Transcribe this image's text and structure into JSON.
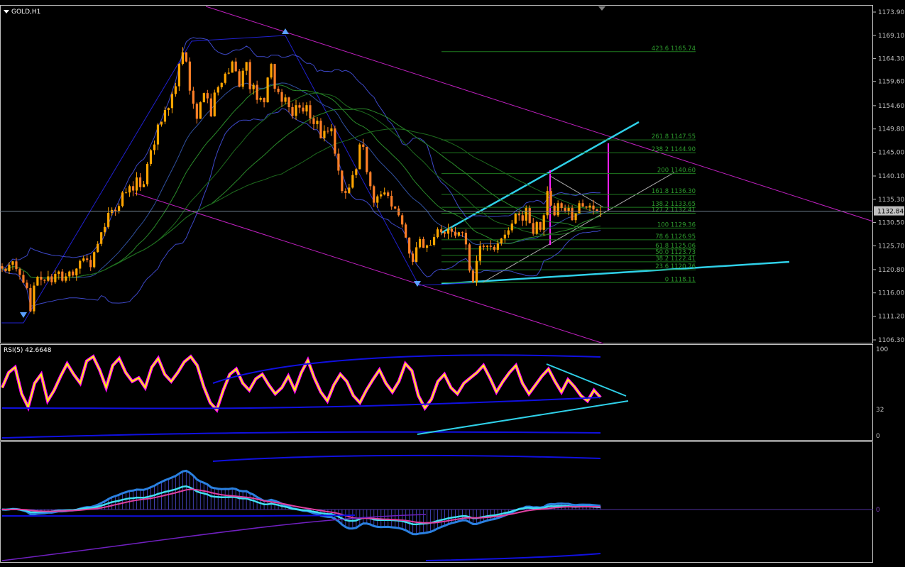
{
  "header": {
    "symbol_label": "GOLD,H1",
    "rsi_label": "RSI(5) 42.6648"
  },
  "colors": {
    "background": "#000000",
    "grid_border": "#c0c0c0",
    "axis_text": "#c0c0c0",
    "candle_up": "#ffa500",
    "candle_down": "#ff7f27",
    "fib": "#1f7a1f",
    "fib_text": "#2e9e2e",
    "channel": "#c020c0",
    "trend_cyan": "#2fd0e8",
    "bollinger": "#3d48c8",
    "zigzag": "#2020d0",
    "rsi_line": "#ffff00",
    "rsi_glow": "#ff00ff",
    "level_blue": "#1010e0",
    "current_price_box": "#c0c0c0"
  },
  "chart_data": {
    "type": "candlestick",
    "symbol": "GOLD",
    "timeframe": "H1",
    "price_axis": {
      "ticks": [
        "1173.90",
        "1169.10",
        "1164.30",
        "1159.60",
        "1154.60",
        "1149.80",
        "1145.00",
        "1140.10",
        "1135.30",
        "1130.50",
        "1125.70",
        "1120.80",
        "1116.00",
        "1111.20",
        "1106.30"
      ],
      "min": 1106.3,
      "max": 1173.9
    },
    "current_price": "1132.84",
    "fibonacci_levels": [
      {
        "label": "423.6 1165.74",
        "price": 1165.74
      },
      {
        "label": "261.8 1147.55",
        "price": 1147.55
      },
      {
        "label": "238.2 1144.90",
        "price": 1144.9
      },
      {
        "label": "200 1140.60",
        "price": 1140.6
      },
      {
        "label": "161.8 1136.30",
        "price": 1136.3
      },
      {
        "label": "138.2 1133.65",
        "price": 1133.65
      },
      {
        "label": "127.2 1132.41",
        "price": 1132.41
      },
      {
        "label": "100 1129.36",
        "price": 1129.36
      },
      {
        "label": "78.6 1126.95",
        "price": 1126.95
      },
      {
        "label": "61.8 1125.06",
        "price": 1125.06
      },
      {
        "label": "50.0 1123.73",
        "price": 1123.73
      },
      {
        "label": "38.2 1122.41",
        "price": 1122.41
      },
      {
        "label": "23.6 1120.76",
        "price": 1120.76
      },
      {
        "label": "0 1118.11",
        "price": 1118.11
      }
    ],
    "close_series": [
      1121.0,
      1120.5,
      1121.8,
      1122.5,
      1120.9,
      1119.7,
      1118.1,
      1117.0,
      1112.2,
      1117.5,
      1119.3,
      1118.7,
      1118.5,
      1119.4,
      1118.2,
      1119.9,
      1120.4,
      1118.5,
      1119.4,
      1120.4,
      1119.6,
      1121.0,
      1122.6,
      1123.1,
      1122.8,
      1121.3,
      1124.4,
      1126.1,
      1128.5,
      1129.6,
      1132.5,
      1133.1,
      1132.9,
      1133.9,
      1136.7,
      1136.7,
      1138.0,
      1137.1,
      1139.8,
      1137.8,
      1138.4,
      1142.6,
      1145.4,
      1146.6,
      1150.7,
      1151.3,
      1153.7,
      1154.1,
      1157.0,
      1158.6,
      1163.2,
      1165.6,
      1163.7,
      1157.7,
      1155.0,
      1151.9,
      1155.3,
      1157.2,
      1156.1,
      1152.4,
      1157.3,
      1158.4,
      1159.3,
      1161.2,
      1161.4,
      1163.7,
      1161.7,
      1158.5,
      1161.8,
      1163.6,
      1158.0,
      1158.9,
      1155.8,
      1156.2,
      1155.3,
      1160.4,
      1163.2,
      1158.1,
      1157.4,
      1155.4,
      1156.3,
      1154.3,
      1152.5,
      1154.7,
      1154.2,
      1153.4,
      1154.7,
      1152.0,
      1150.8,
      1151.5,
      1147.9,
      1149.4,
      1149.3,
      1149.9,
      1144.7,
      1141.2,
      1137.0,
      1136.6,
      1137.7,
      1140.3,
      1141.5,
      1146.6,
      1146.1,
      1140.9,
      1138.0,
      1134.6,
      1135.9,
      1136.3,
      1136.7,
      1136.0,
      1133.8,
      1133.4,
      1132.0,
      1130.1,
      1127.4,
      1124.1,
      1122.4,
      1125.4,
      1127.1,
      1125.3,
      1125.8,
      1125.9,
      1127.5,
      1129.1,
      1128.5,
      1128.2,
      1129.2,
      1128.6,
      1127.8,
      1128.5,
      1128.4,
      1126.0,
      1120.6,
      1118.2,
      1122.6,
      1125.7,
      1125.5,
      1125.7,
      1125.5,
      1124.9,
      1126.2,
      1127.2,
      1128.0,
      1128.9,
      1130.3,
      1132.3,
      1132.0,
      1130.9,
      1133.5,
      1130.4,
      1128.2,
      1130.6,
      1129.0,
      1132.0,
      1137.0,
      1134.0,
      1132.0,
      1134.5,
      1133.5,
      1132.8,
      1133.5,
      1131.0,
      1132.4,
      1134.5,
      1133.8,
      1133.6,
      1134.0,
      1133.2,
      1132.8,
      1132.84
    ],
    "rsi": {
      "period": 5,
      "value": "42.6648",
      "axis_ticks": [
        "100",
        "32",
        "0"
      ],
      "values": [
        55,
        72,
        78,
        48,
        33,
        60,
        70,
        40,
        52,
        68,
        82,
        70,
        60,
        85,
        90,
        75,
        55,
        80,
        88,
        72,
        62,
        66,
        55,
        78,
        88,
        70,
        62,
        72,
        84,
        90,
        80,
        56,
        38,
        30,
        52,
        70,
        76,
        60,
        52,
        65,
        70,
        58,
        48,
        55,
        68,
        52,
        72,
        86,
        66,
        50,
        40,
        58,
        70,
        62,
        46,
        38,
        52,
        64,
        75,
        60,
        50,
        62,
        82,
        74,
        46,
        32,
        42,
        62,
        70,
        55,
        48,
        60,
        66,
        72,
        80,
        66,
        50,
        62,
        72,
        80,
        60,
        48,
        58,
        68,
        76,
        62,
        50,
        64,
        56,
        46,
        40,
        52,
        44
      ]
    },
    "macd_panel": {
      "axis_tick": "0"
    }
  }
}
